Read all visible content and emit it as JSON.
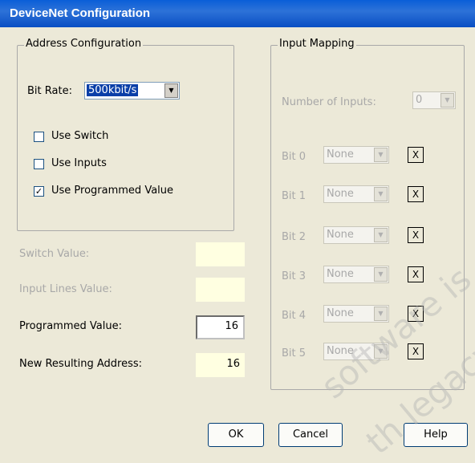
{
  "window": {
    "title": "DeviceNet Configuration"
  },
  "address": {
    "legend": "Address Configuration",
    "bit_rate_label": "Bit Rate:",
    "bit_rate_value": "500kbit/s",
    "use_switch_label": "Use Switch",
    "use_switch_checked": false,
    "use_inputs_label": "Use Inputs",
    "use_inputs_checked": false,
    "use_programmed_label": "Use Programmed Value",
    "use_programmed_checked": true
  },
  "values": {
    "switch_label": "Switch Value:",
    "switch_value": "",
    "input_lines_label": "Input Lines Value:",
    "input_lines_value": "",
    "programmed_label": "Programmed Value:",
    "programmed_value": "16",
    "resulting_label": "New Resulting Address:",
    "resulting_value": "16"
  },
  "mapping": {
    "legend": "Input Mapping",
    "num_inputs_label": "Number of Inputs:",
    "num_inputs_value": "0",
    "bits": [
      {
        "label": "Bit 0",
        "value": "None",
        "x": "X"
      },
      {
        "label": "Bit 1",
        "value": "None",
        "x": "X"
      },
      {
        "label": "Bit 2",
        "value": "None",
        "x": "X"
      },
      {
        "label": "Bit 3",
        "value": "None",
        "x": "X"
      },
      {
        "label": "Bit 4",
        "value": "None",
        "x": "X"
      },
      {
        "label": "Bit 5",
        "value": "None",
        "x": "X"
      }
    ]
  },
  "buttons": {
    "ok": "OK",
    "cancel": "Cancel",
    "help": "Help"
  },
  "watermark": [
    "software is",
    "th legacy"
  ]
}
